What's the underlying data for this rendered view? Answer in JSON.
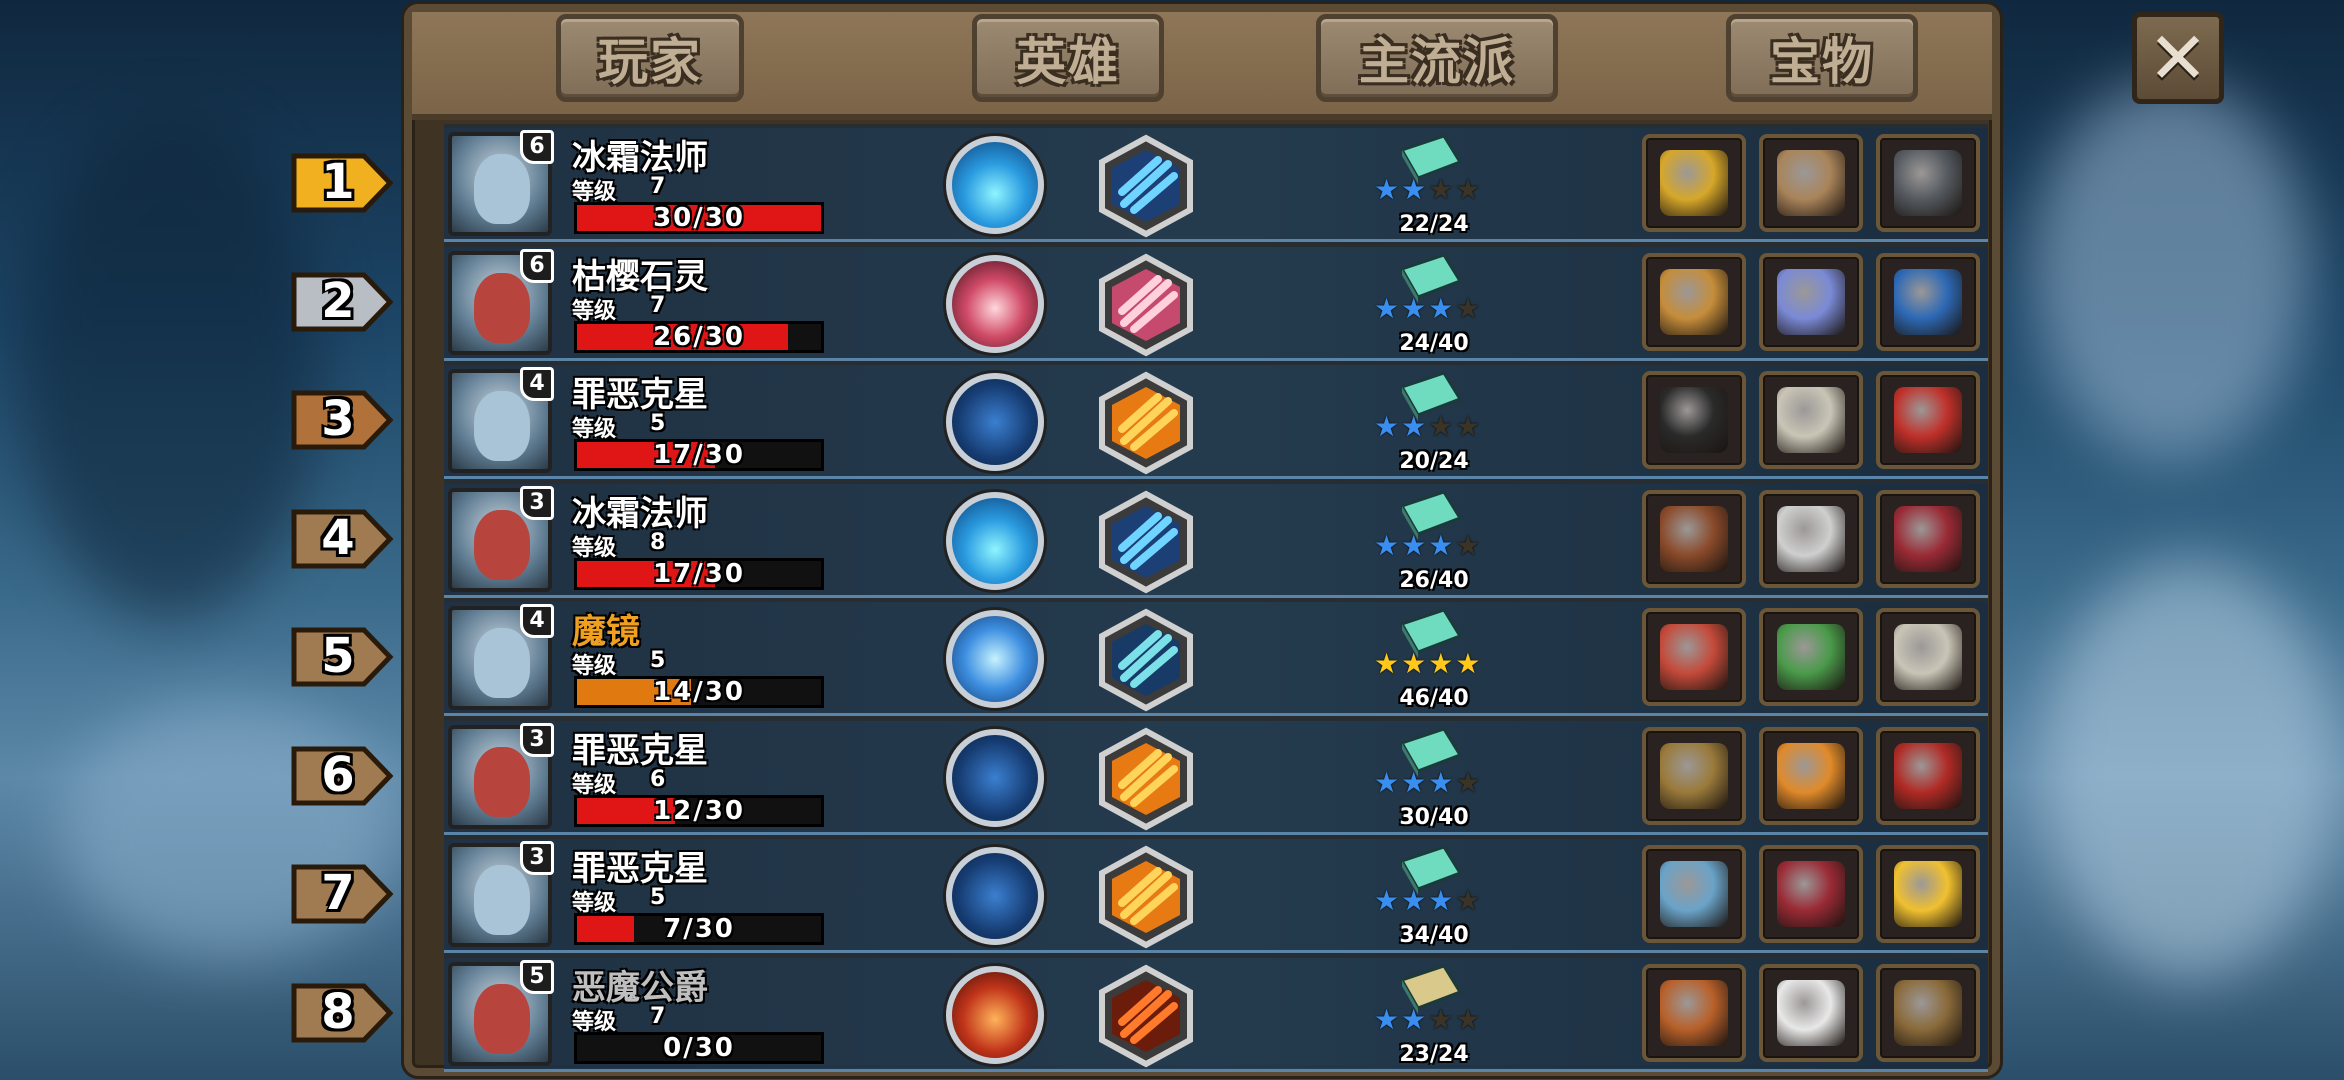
{
  "tabs": [
    "玩家",
    "英雄",
    "主流派",
    "宝物"
  ],
  "close_label": "✕",
  "level_label": "等级",
  "rows": [
    {
      "rank": "1",
      "rank_color": "#f0b020",
      "name": "冰霜法师",
      "name_color": "#ffffff",
      "star_level": "6",
      "level": "7",
      "hp": "30/30",
      "hp_value": 30,
      "hp_max": 30,
      "bar_color": "#e01515",
      "skill": "frost-orb",
      "school_stars": 2,
      "school_score": "22/24",
      "items": [
        "golden-chalice",
        "balance-scale",
        "dark-tablet"
      ]
    },
    {
      "rank": "2",
      "rank_color": "#b8bec4",
      "name": "枯樱石灵",
      "name_color": "#ffffff",
      "star_level": "6",
      "level": "7",
      "hp": "26/30",
      "hp_value": 26,
      "hp_max": 30,
      "bar_color": "#e01515",
      "skill": "crimson-orb",
      "school_stars": 3,
      "school_score": "24/40",
      "items": [
        "broom",
        "gem-ring",
        "treasure-chest"
      ]
    },
    {
      "rank": "3",
      "rank_color": "#b0723a",
      "name": "罪恶克星",
      "name_color": "#ffffff",
      "star_level": "4",
      "level": "5",
      "hp": "17/30",
      "hp_value": 17,
      "hp_max": 30,
      "bar_color": "#e01515",
      "skill": "star-emblem",
      "school_stars": 2,
      "school_score": "20/24",
      "items": [
        "feather-hat",
        "silver-coin",
        "red-spellbook"
      ]
    },
    {
      "rank": "4",
      "rank_color": "#a07a50",
      "name": "冰霜法师",
      "name_color": "#ffffff",
      "star_level": "3",
      "level": "8",
      "hp": "17/30",
      "hp_value": 17,
      "hp_max": 30,
      "bar_color": "#e01515",
      "skill": "frost-orb",
      "school_stars": 3,
      "school_score": "26/40",
      "items": [
        "leather-armor",
        "boot",
        "star-tome"
      ]
    },
    {
      "rank": "5",
      "rank_color": "#a07a50",
      "name": "魔镜",
      "name_color": "#f0a020",
      "star_level": "4",
      "level": "5",
      "hp": "14/30",
      "hp_value": 14,
      "hp_max": 30,
      "bar_color": "#e07a10",
      "skill": "lightning-orb",
      "school_stars": 4,
      "school_score": "46/40",
      "items": [
        "coral",
        "green-books",
        "silver-coin"
      ]
    },
    {
      "rank": "6",
      "rank_color": "#a07a50",
      "name": "罪恶克星",
      "name_color": "#ffffff",
      "star_level": "3",
      "level": "6",
      "hp": "12/30",
      "hp_value": 12,
      "hp_max": 30,
      "bar_color": "#e01515",
      "skill": "star-emblem",
      "school_stars": 3,
      "school_score": "30/40",
      "items": [
        "wand",
        "vip-card",
        "rocket-boot"
      ]
    },
    {
      "rank": "7",
      "rank_color": "#a07a50",
      "name": "罪恶克星",
      "name_color": "#ffffff",
      "star_level": "3",
      "level": "5",
      "hp": "7/30",
      "hp_value": 7,
      "hp_max": 30,
      "bar_color": "#e01515",
      "skill": "star-emblem",
      "school_stars": 3,
      "school_score": "34/40",
      "items": [
        "robot",
        "star-tome",
        "golden-crown"
      ]
    },
    {
      "rank": "8",
      "rank_color": "#a07a50",
      "name": "恶魔公爵",
      "name_color": "#bfbfbf",
      "star_level": "5",
      "level": "7",
      "hp": "0/30",
      "hp_value": 0,
      "hp_max": 30,
      "bar_color": "#e01515",
      "skill": "fire-orb",
      "school_stars": 2,
      "school_score": "23/24",
      "items": [
        "fruit-bowl",
        "first-aid-kit",
        "telescope"
      ]
    }
  ]
}
